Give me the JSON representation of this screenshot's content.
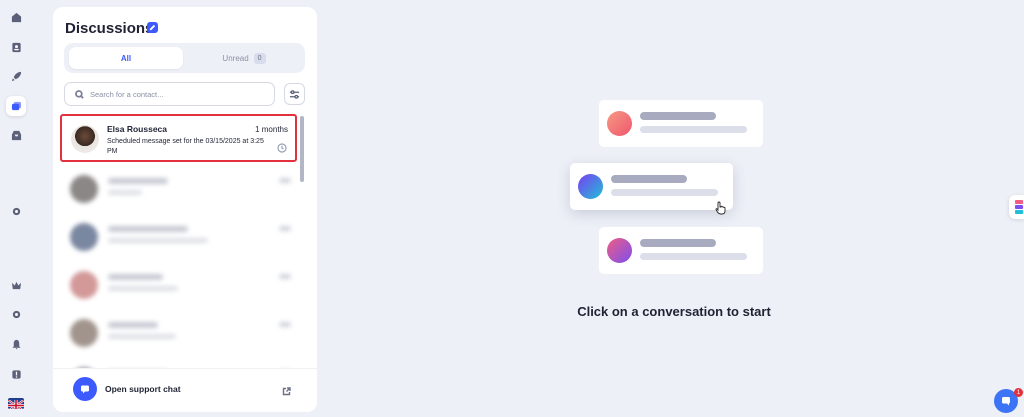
{
  "rail": {
    "items": [
      {
        "name": "home-icon"
      },
      {
        "name": "contacts-icon"
      },
      {
        "name": "rocket-icon"
      },
      {
        "name": "discussions-icon",
        "active": true
      },
      {
        "name": "inbox-icon"
      },
      {
        "name": "gear-icon"
      },
      {
        "name": "crown-icon"
      },
      {
        "name": "settings-icon"
      },
      {
        "name": "bell-icon"
      },
      {
        "name": "help-icon"
      },
      {
        "name": "language-flag-icon"
      }
    ]
  },
  "discussions": {
    "title": "Discussions",
    "tabs": [
      {
        "label": "All",
        "active": true
      },
      {
        "label": "Unread",
        "count": "0"
      }
    ],
    "search": {
      "placeholder": "Search for a contact..."
    },
    "selected_conversation": {
      "name": "Elsa Rousseca",
      "time": "1 months",
      "preview": "Scheduled message set for the 03/15/2025 at 3:25 PM"
    },
    "support_label": "Open support chat"
  },
  "main": {
    "empty_state_text": "Click on a conversation to start"
  },
  "chat_widget": {
    "badge_count": "1"
  },
  "colors": {
    "accent": "#3d5afe",
    "selected_border": "#e2303c",
    "background": "#eef0f7"
  }
}
